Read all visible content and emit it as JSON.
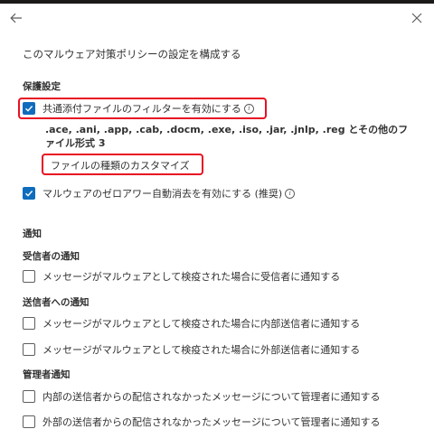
{
  "panel": {
    "subtitle": "このマルウェア対策ポリシーの設定を構成する"
  },
  "protection": {
    "heading": "保護設定",
    "common_attachments_label": "共通添付ファイルのフィルターを有効にする",
    "common_attachments_checked": true,
    "file_types_text": ".ace, .ani, .app, .cab, .docm, .exe, .iso, .jar, .jnlp, .reg とその他のファイル形式 3",
    "customize_link": "ファイルの種類のカスタマイズ",
    "zap_label": "マルウェアのゼロアワー自動消去を有効にする (推奨)",
    "zap_checked": true
  },
  "notifications": {
    "heading": "通知",
    "recipient": {
      "heading": "受信者の通知",
      "items": [
        {
          "label": "メッセージがマルウェアとして検疫された場合に受信者に通知する",
          "checked": false
        }
      ]
    },
    "sender": {
      "heading": "送信者への通知",
      "items": [
        {
          "label": "メッセージがマルウェアとして検疫された場合に内部送信者に通知する",
          "checked": false
        },
        {
          "label": "メッセージがマルウェアとして検疫された場合に外部送信者に通知する",
          "checked": false
        }
      ]
    },
    "admin": {
      "heading": "管理者通知",
      "items": [
        {
          "label": "内部の送信者からの配信されなかったメッセージについて管理者に通知する",
          "checked": false
        },
        {
          "label": "外部の送信者からの配信されなかったメッセージについて管理者に通知する",
          "checked": false
        }
      ]
    }
  },
  "icons": {
    "back": "back-arrow-icon",
    "close": "close-icon",
    "info": "info-icon",
    "check": "checkmark-icon"
  },
  "colors": {
    "accent": "#0f6cbd",
    "highlight": "#e81123",
    "text": "#323130"
  }
}
